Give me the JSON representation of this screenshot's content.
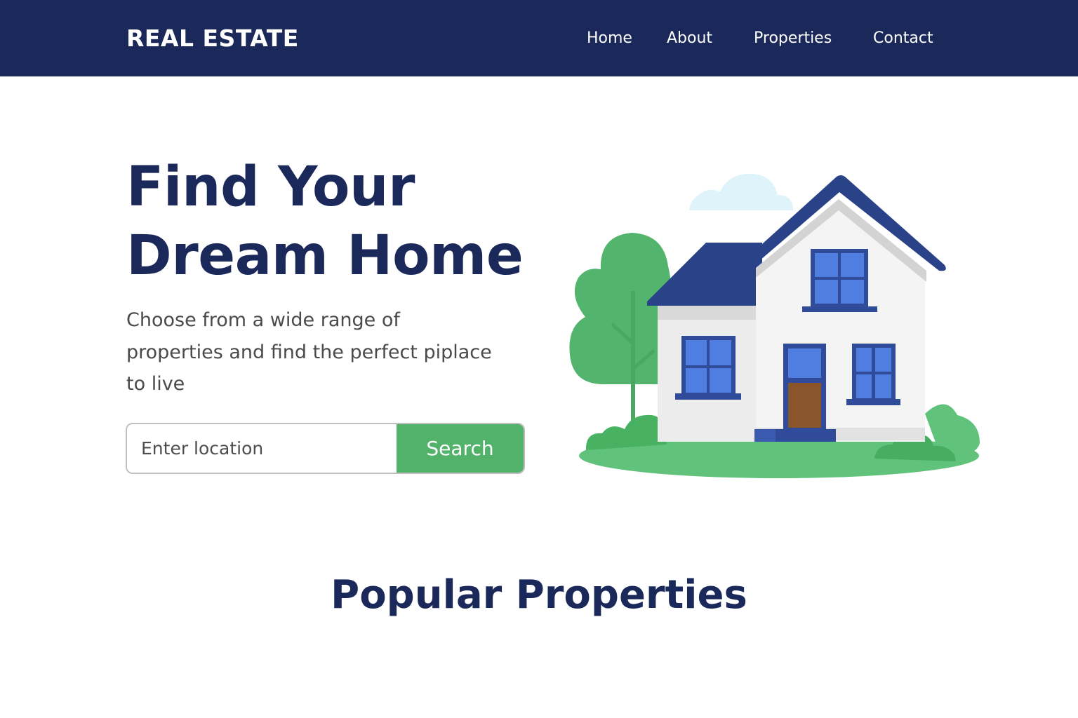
{
  "navbar": {
    "brand": "REAL ESTATE",
    "links": [
      {
        "label": "Home"
      },
      {
        "label": "About"
      },
      {
        "label": "Properties"
      },
      {
        "label": "Contact"
      }
    ]
  },
  "hero": {
    "title_lines": [
      "Find Your",
      "Dream Home"
    ],
    "subtitle_lines": [
      "Choose from a wide range of",
      "properties and find the perfect piplace",
      "to live"
    ],
    "search": {
      "placeholder": "Enter location",
      "value": "",
      "button_label": "Search"
    },
    "illustration": "house-illustration"
  },
  "popular": {
    "title": "Popular Properties"
  },
  "colors": {
    "navbar_bg": "#1b295a",
    "heading": "#1b295a",
    "accent_green": "#52b26a",
    "roof_blue": "#2a4287",
    "window_blue": "#4f7de0",
    "door_brown": "#8b552c"
  }
}
